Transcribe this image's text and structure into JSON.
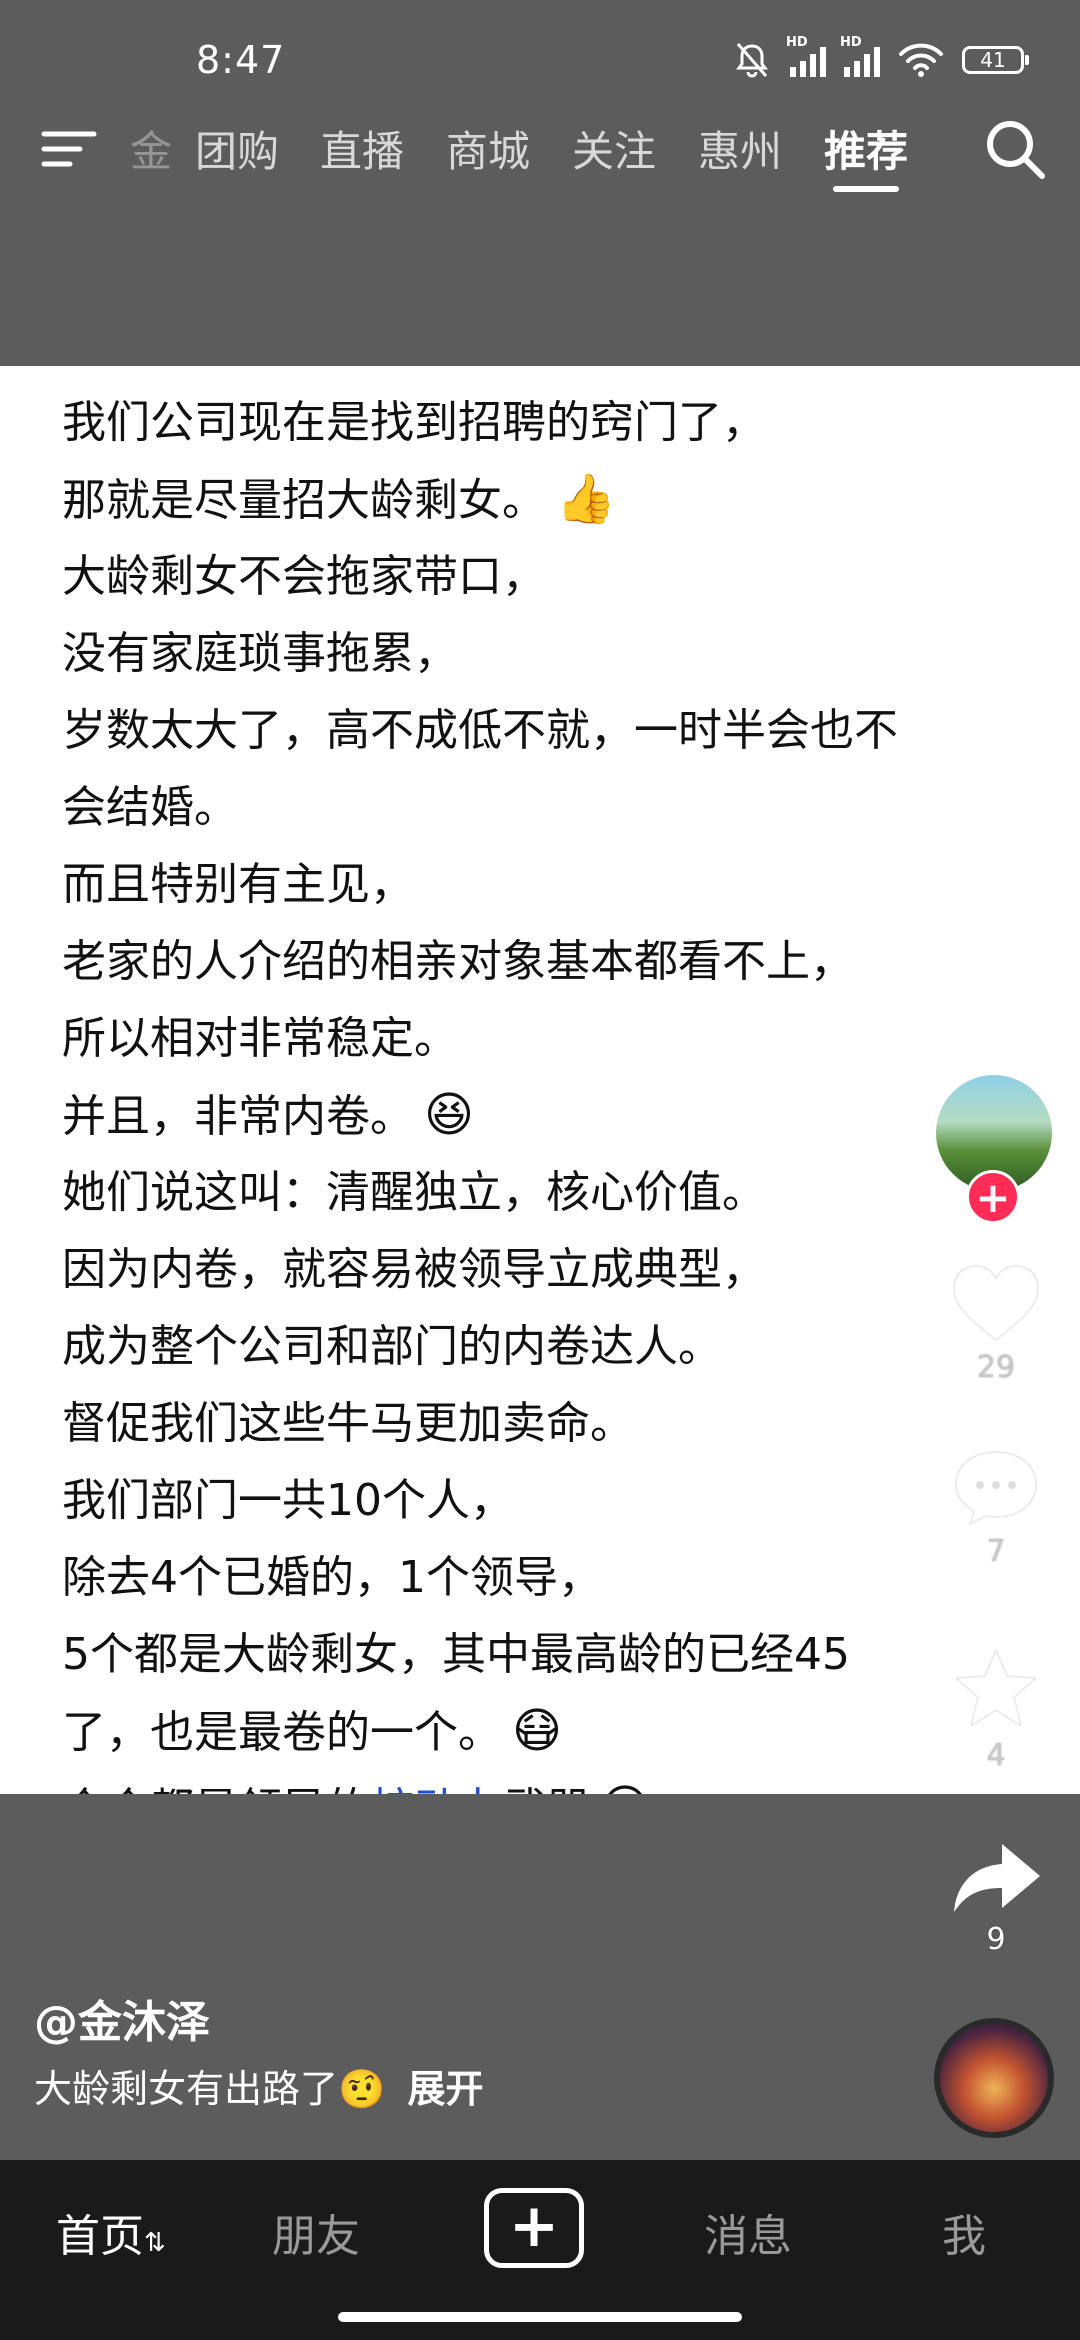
{
  "status_bar": {
    "time": "8:47",
    "battery": "41",
    "icons": [
      "mute-bell-icon",
      "signal-hd-icon",
      "signal-hd-icon",
      "wifi-icon",
      "battery-icon"
    ]
  },
  "top_nav": {
    "tabs": [
      {
        "label": "金",
        "state": "faded"
      },
      {
        "label": "团购"
      },
      {
        "label": "直播"
      },
      {
        "label": "商城"
      },
      {
        "label": "关注"
      },
      {
        "label": "惠州"
      },
      {
        "label": "推荐",
        "state": "active"
      }
    ]
  },
  "post": {
    "lines": [
      "我们公司现在是找到招聘的窍门了，",
      "那就是尽量招大龄剩女。",
      "大龄剩女不会拖家带口，",
      "没有家庭琐事拖累，",
      "岁数太大了，高不成低不就，一时半会也不",
      "会结婚。",
      "而且特别有主见，",
      "老家的人介绍的相亲对象基本都看不上，",
      "所以相对非常稳定。",
      "并且，非常内卷。",
      "她们说这叫：清醒独立，核心价值。",
      "因为内卷，就容易被领导立成典型，",
      "成为整个公司和部门的内卷达人。",
      "督促我们这些牛马更加卖命。",
      "我们部门一共10个人，",
      "除去4个已婚的，1个领导，",
      "5个都是大龄剩女，其中最高龄的已经45",
      "了，也是最卷的一个。",
      "个个都是领导的",
      "核动力",
      "武器"
    ],
    "emoji_thumbs": "👍",
    "emoji_laugh": "😆",
    "emoji_mask": "😷",
    "emoji_grin": "😅"
  },
  "actions": {
    "like_count": "29",
    "comment_count": "7",
    "favorite_count": "4",
    "share_count": "9",
    "follow_symbol": "+"
  },
  "author": {
    "handle": "@金沐泽",
    "caption": "大龄剩女有出路了",
    "caption_emoji": "🤨",
    "expand_label": "展开"
  },
  "bottom_nav": {
    "home": "首页",
    "home_suffix": "⇅",
    "friends": "朋友",
    "add": "+",
    "messages": "消息",
    "me": "我"
  }
}
